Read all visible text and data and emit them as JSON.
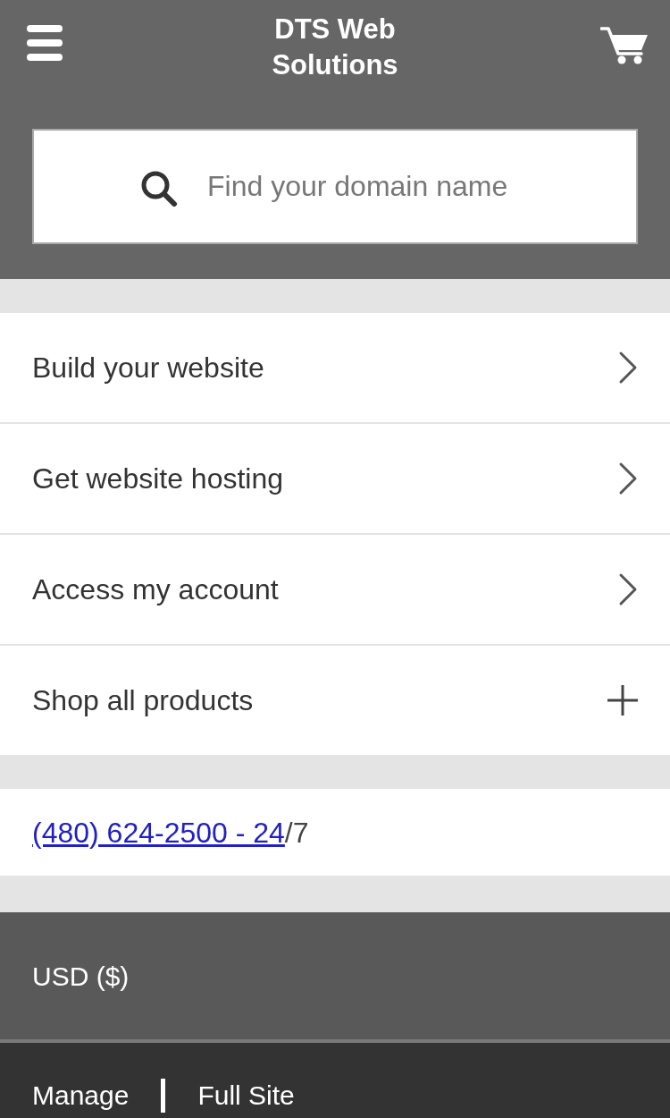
{
  "header": {
    "title": "DTS Web Solutions"
  },
  "search": {
    "placeholder": "Find your domain name"
  },
  "menu": [
    {
      "label": "Build your website",
      "kind": "link"
    },
    {
      "label": "Get website hosting",
      "kind": "link"
    },
    {
      "label": "Access my account",
      "kind": "link"
    },
    {
      "label": "Shop all products",
      "kind": "expand"
    }
  ],
  "contact": {
    "phone_link": "(480) 624-2500 - 24",
    "suffix": "/7"
  },
  "currency": {
    "label": "USD ($)"
  },
  "footer": {
    "links": [
      "Manage",
      "Full Site"
    ]
  }
}
